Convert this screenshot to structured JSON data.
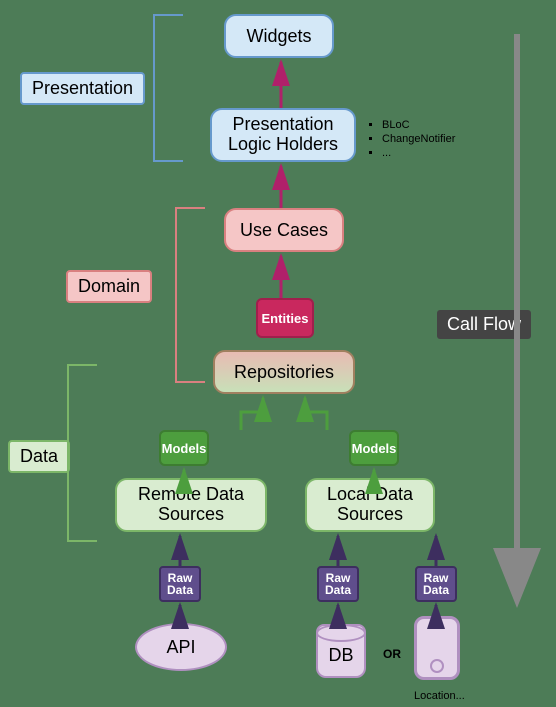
{
  "layers": {
    "presentation": "Presentation",
    "domain": "Domain",
    "data": "Data"
  },
  "boxes": {
    "widgets": "Widgets",
    "plh1": "Presentation",
    "plh2": "Logic Holders",
    "usecases": "Use Cases",
    "entities": "Entities",
    "repositories": "Repositories",
    "models1": "Models",
    "models2": "Models",
    "remote1": "Remote Data",
    "remote2": "Sources",
    "local1": "Local Data",
    "local2": "Sources",
    "raw1a": "Raw",
    "raw1b": "Data",
    "raw2a": "Raw",
    "raw2b": "Data",
    "raw3a": "Raw",
    "raw3b": "Data"
  },
  "sources": {
    "api": "API",
    "db": "DB",
    "or": "OR",
    "location": "Location..."
  },
  "bullets": [
    "BLoC",
    "ChangeNotifier",
    "..."
  ],
  "callflow": "Call Flow"
}
